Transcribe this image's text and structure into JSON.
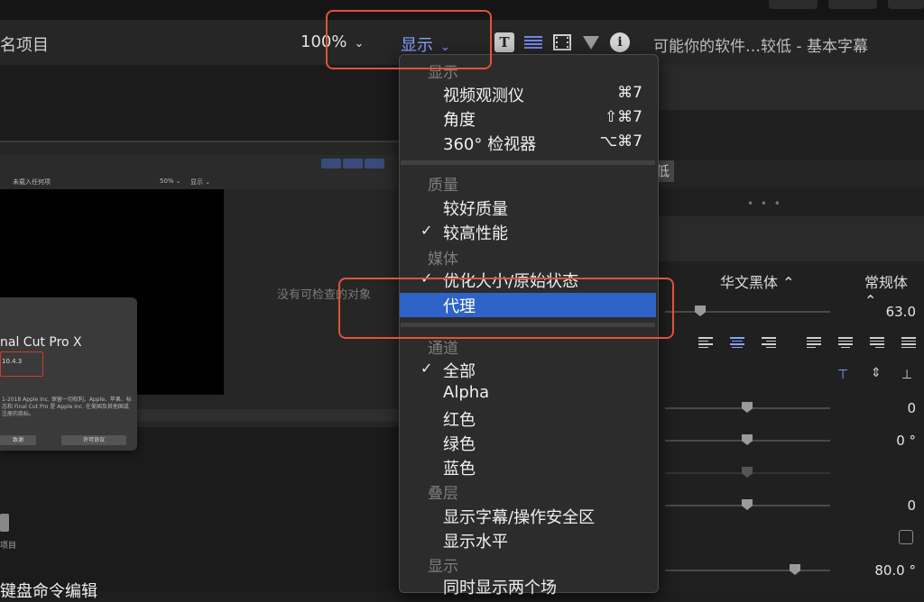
{
  "header": {
    "project_title": "名项目",
    "zoom_label": "100%",
    "display_label": "显示",
    "inspector_title": "可能你的软件…较低 - 基本字幕",
    "info_glyph": "i",
    "text_tool_glyph": "T"
  },
  "embedded_viewer": {
    "no_media": "未载入任何项",
    "zoom": "50% ⌄",
    "display": "显示 ⌄",
    "no_inspect": "没有可检查的对象"
  },
  "about_dialog": {
    "app_name": "nal Cut Pro X",
    "version": "10.4.3",
    "copyright": "1-2018 Apple Inc. 保留一切权利。Apple、苹果、标志和 Final Cut Pro 是 Apple Inc. 在美国及其他国或注册的商标。",
    "button_left": "致谢",
    "button_right": "许可协议"
  },
  "library": {
    "label": "项目"
  },
  "bottom_text": "键盘命令编辑",
  "inspector": {
    "chip_text": "低",
    "font_name": "华文黑体 ⌃",
    "font_style": "常规体 ⌃",
    "size_value": "63.0",
    "values": [
      "0",
      "0 °",
      "0",
      "80.0 °"
    ]
  },
  "menu": {
    "head_display": "显示",
    "video_scopes": "视频观测仪",
    "video_scopes_sc": "⌘7",
    "angles": "角度",
    "angles_sc": "⇧⌘7",
    "viewer360": "360° 检视器",
    "viewer360_sc": "⌥⌘7",
    "head_quality": "质量",
    "better_quality": "较好质量",
    "better_performance": "较高性能",
    "head_media": "媒体",
    "optimized": "优化大小/原始状态",
    "proxy": "代理",
    "head_channels": "通道",
    "all": "全部",
    "alpha": "Alpha",
    "red": "红色",
    "green": "绿色",
    "blue": "蓝色",
    "head_overlays": "叠层",
    "title_safe": "显示字幕/操作安全区",
    "horizon": "显示水平",
    "head_display2": "显示",
    "both_fields": "同时显示两个场",
    "check": "✓"
  }
}
